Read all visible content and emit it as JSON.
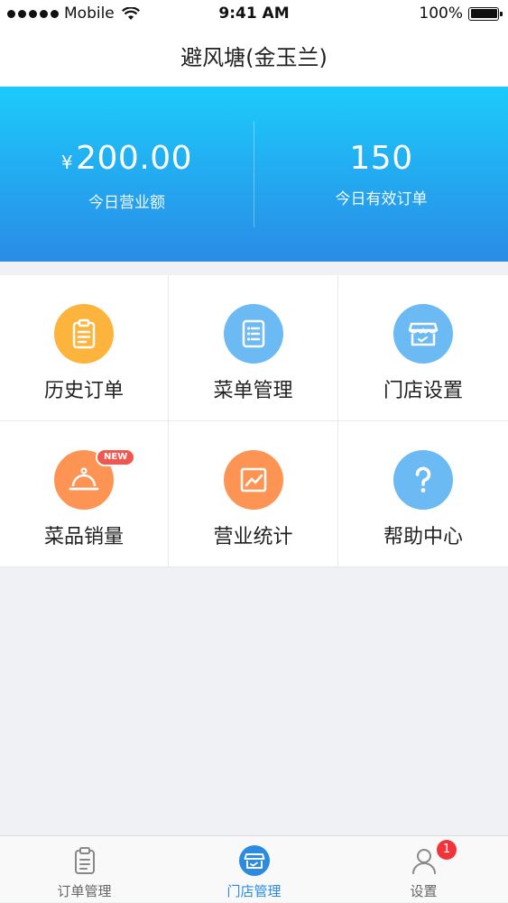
{
  "status_bar": {
    "carrier": "Mobile",
    "time": "9:41 AM",
    "battery": "100%"
  },
  "nav": {
    "title": "避风塘(金玉兰)"
  },
  "summary": {
    "revenue_currency": "¥",
    "revenue_value": "200.00",
    "revenue_label": "今日营业额",
    "orders_value": "150",
    "orders_label": "今日有效订单"
  },
  "menu": {
    "items": [
      {
        "label": "历史订单",
        "icon": "clipboard-icon",
        "color": "#fcb43c"
      },
      {
        "label": "菜单管理",
        "icon": "checklist-icon",
        "color": "#6bbaf3"
      },
      {
        "label": "门店设置",
        "icon": "storefront-icon",
        "color": "#6bbaf3"
      },
      {
        "label": "菜品销量",
        "icon": "cloche-icon",
        "color": "#fd9454",
        "badge": "NEW"
      },
      {
        "label": "营业统计",
        "icon": "chart-icon",
        "color": "#fd9454"
      },
      {
        "label": "帮助中心",
        "icon": "question-icon",
        "color": "#6bbaf3"
      }
    ]
  },
  "tabs": {
    "items": [
      {
        "label": "订单管理",
        "icon": "clipboard-icon"
      },
      {
        "label": "门店管理",
        "icon": "storefront-icon",
        "active": true
      },
      {
        "label": "设置",
        "icon": "user-icon",
        "badge": "1"
      }
    ]
  },
  "colors": {
    "accent": "#2b8be0",
    "hero_top": "#1ccbfb",
    "hero_bottom": "#2a8be6",
    "badge_red": "#f0343a"
  }
}
